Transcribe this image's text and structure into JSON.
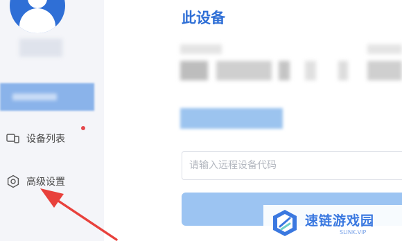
{
  "sidebar": {
    "items": [
      {
        "label": "设备列表",
        "icon": "devices-icon",
        "has_notification_dot": true
      },
      {
        "label": "高级设置",
        "icon": "settings-icon"
      }
    ]
  },
  "main": {
    "title": "此设备",
    "remote_code": {
      "placeholder": "请输入远程设备代码",
      "value": ""
    },
    "connect_button_label": ""
  },
  "watermark": {
    "title": "速链游戏园",
    "subtitle": "SLINK.VIP"
  },
  "colors": {
    "accent": "#2f6fd6",
    "button": "#9cc4f2",
    "annotation_arrow": "#e8413c",
    "notification_dot": "#e5484d"
  }
}
